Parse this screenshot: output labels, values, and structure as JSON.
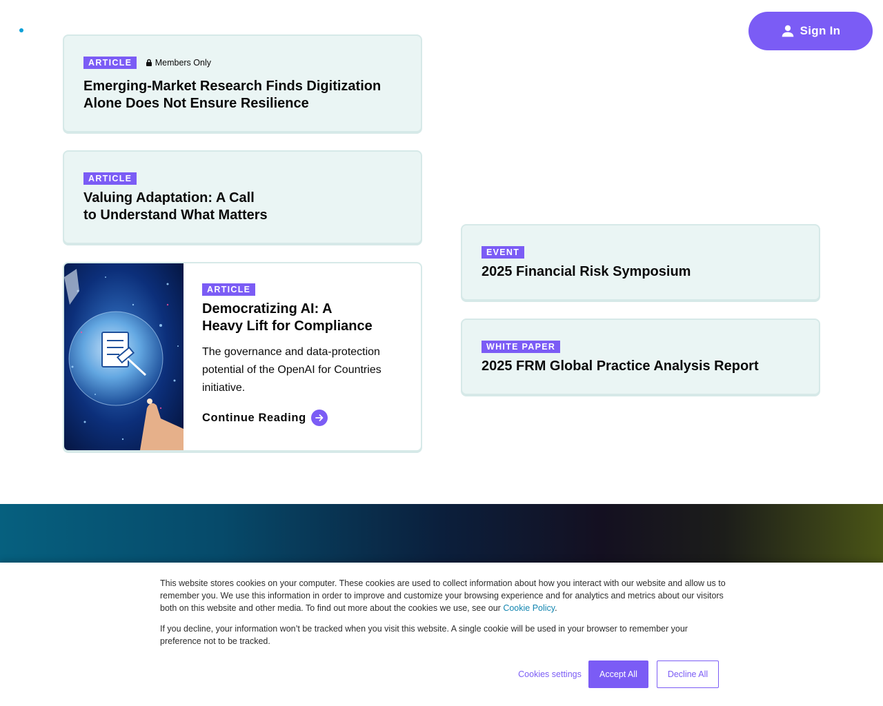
{
  "header": {
    "sign_in_label": "Sign In",
    "colors": {
      "accent": "#7b5cf5",
      "dot": "#0aa0d8"
    }
  },
  "cards": [
    {
      "badge": "ARTICLE",
      "members_label": "Members Only",
      "title_line1": "Emerging-Market Research Finds Digitization",
      "title_line2": "Alone Does Not Ensure Resilience"
    },
    {
      "badge": "ARTICLE",
      "title_line1": "Valuing Adaptation: A Call",
      "title_line2": "to Understand What Matters"
    },
    {
      "badge": "ARTICLE",
      "title_line1": "Democratizing AI: A",
      "title_line2": "Heavy Lift for Compliance",
      "description": "The governance and data-protection potential of the OpenAI for Countries initiative.",
      "cta": "Continue Reading"
    },
    {
      "badge": "EVENT",
      "title": "2025 Financial Risk Symposium"
    },
    {
      "badge": "WHITE PAPER",
      "title": "2025 FRM Global Practice Analysis Report"
    }
  ],
  "cookie_banner": {
    "text1": "This website stores cookies on your computer. These cookies are used to collect information about how you interact with our website and allow us to remember you. We use this information in order to improve and customize your browsing experience and for analytics and metrics about our visitors both on this website and other media. To find out more about the cookies we use, see our",
    "policy_link": "Cookie Policy",
    "period": ".",
    "text2": "If you decline, your information won’t be tracked when you visit this website. A single cookie will be used in your browser to remember your preference not to be tracked.",
    "settings_label": "Cookies settings",
    "accept_label": "Accept All",
    "decline_label": "Decline All"
  }
}
